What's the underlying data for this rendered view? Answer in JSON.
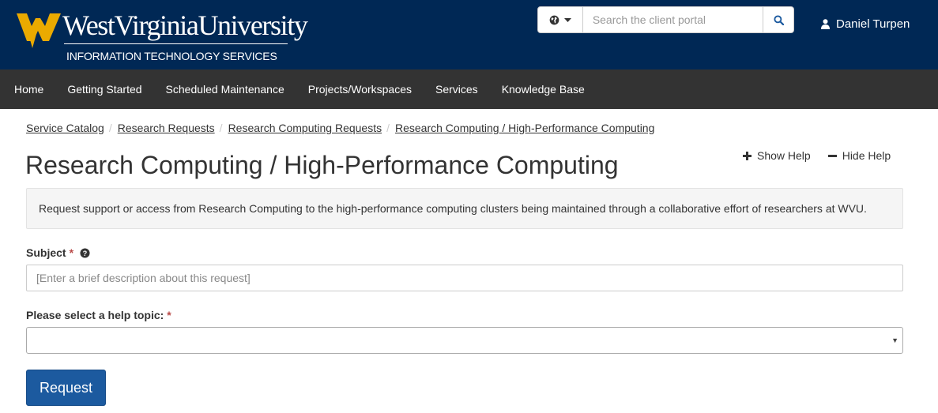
{
  "header": {
    "logo_name": "WestVirginiaUniversity",
    "logo_sub": "INFORMATION TECHNOLOGY SERVICES",
    "search_placeholder": "Search the client portal",
    "user_name": "Daniel Turpen",
    "brand_colors": {
      "navy": "#002855",
      "gold": "#EAAA00"
    }
  },
  "nav": {
    "items": [
      "Home",
      "Getting Started",
      "Scheduled Maintenance",
      "Projects/Workspaces",
      "Services",
      "Knowledge Base"
    ]
  },
  "breadcrumb": [
    "Service Catalog",
    "Research Requests",
    "Research Computing Requests",
    "Research Computing / High-Performance Computing"
  ],
  "page": {
    "title": "Research Computing / High-Performance Computing",
    "show_help": "Show Help",
    "hide_help": "Hide Help",
    "description": "Request support or access from Research Computing to the high-performance computing clusters being maintained through a collaborative effort of researchers at WVU."
  },
  "form": {
    "subject_label": "Subject",
    "subject_placeholder": "[Enter a brief description about this request]",
    "topic_label": "Please select a help topic:",
    "required_mark": "*",
    "submit_label": "Request"
  },
  "icons": [
    "globe-icon",
    "caret-down-icon",
    "search-icon",
    "user-icon",
    "plus-icon",
    "minus-icon",
    "question-circle-icon"
  ]
}
